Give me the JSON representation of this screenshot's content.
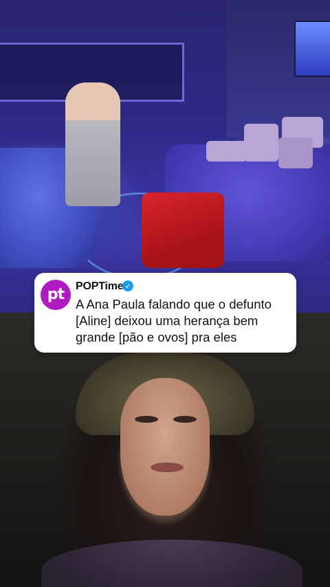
{
  "tweet": {
    "avatar_text": "pt",
    "username": "POPTime",
    "verified_icon": "verified-badge-icon",
    "text_lines": [
      "A Ana Paula falando que o defunto",
      "[Aline] deixou uma herança bem",
      "grande [pão e ovos] pra eles"
    ]
  },
  "colors": {
    "avatar_bg": "#b01ac2",
    "verified_blue": "#1d9bf0",
    "card_bg": "#ffffff"
  }
}
